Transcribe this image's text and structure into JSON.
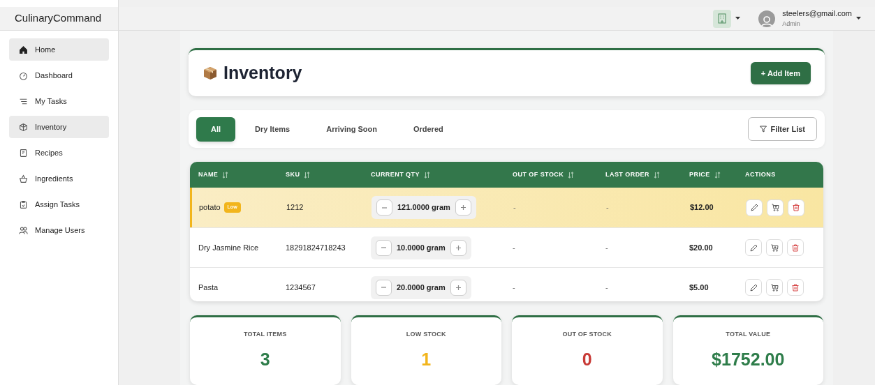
{
  "app_name": "CulinaryCommand",
  "sidebar": {
    "items": [
      {
        "label": "Home",
        "selected": true
      },
      {
        "label": "Dashboard",
        "selected": false
      },
      {
        "label": "My Tasks",
        "selected": false
      },
      {
        "label": "Inventory",
        "selected": true
      },
      {
        "label": "Recipes",
        "selected": false
      },
      {
        "label": "Ingredients",
        "selected": false
      },
      {
        "label": "Assign Tasks",
        "selected": false
      },
      {
        "label": "Manage Users",
        "selected": false
      }
    ]
  },
  "user": {
    "email": "steelers@gmail.com",
    "role": "Admin"
  },
  "page": {
    "title": "Inventory",
    "add_button": "+ Add Item"
  },
  "tabs": [
    {
      "label": "All",
      "selected": true
    },
    {
      "label": "Dry Items",
      "selected": false
    },
    {
      "label": "Arriving Soon",
      "selected": false
    },
    {
      "label": "Ordered",
      "selected": false
    }
  ],
  "filter_button": "Filter List",
  "table": {
    "columns": [
      {
        "label": "NAME",
        "sortable": true
      },
      {
        "label": "SKU",
        "sortable": true
      },
      {
        "label": "CURRENT QTY",
        "sortable": true
      },
      {
        "label": "OUT OF STOCK",
        "sortable": true
      },
      {
        "label": "LAST ORDER",
        "sortable": true
      },
      {
        "label": "PRICE",
        "sortable": true
      },
      {
        "label": "ACTIONS",
        "sortable": false
      }
    ],
    "rows": [
      {
        "name": "potato",
        "badge": "Low",
        "low": true,
        "sku": "1212",
        "qty": "121.0000 gram",
        "out_of_stock": "-",
        "last_order": "-",
        "price": "$12.00"
      },
      {
        "name": "Dry Jasmine Rice",
        "low": false,
        "sku": "18291824718243",
        "qty": "10.0000 gram",
        "out_of_stock": "-",
        "last_order": "-",
        "price": "$20.00"
      },
      {
        "name": "Pasta",
        "low": false,
        "sku": "1234567",
        "qty": "20.0000 gram",
        "out_of_stock": "-",
        "last_order": "-",
        "price": "$5.00"
      }
    ]
  },
  "stats": [
    {
      "label": "TOTAL ITEMS",
      "value": "3",
      "color": "#2e7d4a"
    },
    {
      "label": "LOW STOCK",
      "value": "1",
      "color": "#f2b51c"
    },
    {
      "label": "OUT OF STOCK",
      "value": "0",
      "color": "#c83a36"
    },
    {
      "label": "TOTAL VALUE",
      "value": "$1752.00",
      "color": "#2e7d4a"
    }
  ]
}
